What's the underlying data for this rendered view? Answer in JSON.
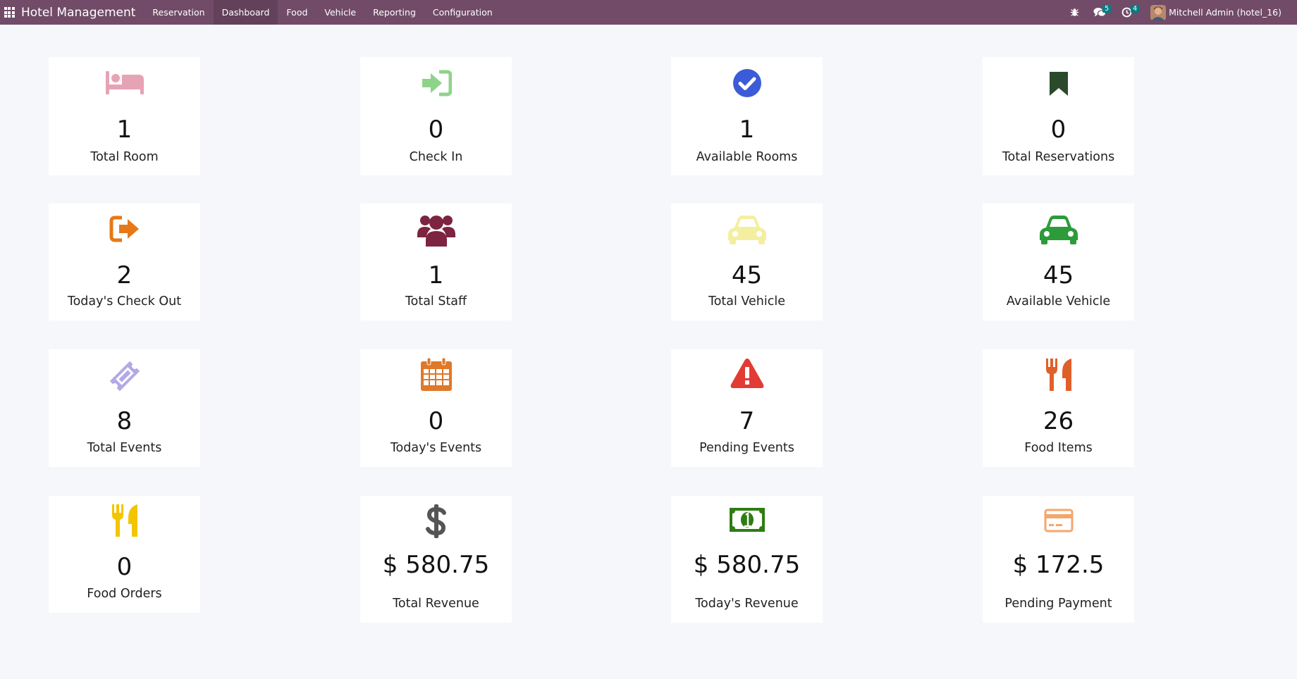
{
  "navbar": {
    "brand": "Hotel Management",
    "menu": [
      "Reservation",
      "Dashboard",
      "Food",
      "Vehicle",
      "Reporting",
      "Configuration"
    ],
    "active_menu": "Dashboard",
    "messages_badge": "5",
    "activities_badge": "4",
    "user": "Mitchell Admin (hotel_16)"
  },
  "cards": [
    {
      "value": "1",
      "label": "Total Room",
      "icon": "bed-icon",
      "color": "#e7a3b6"
    },
    {
      "value": "0",
      "label": "Check In",
      "icon": "sign-in-icon",
      "color": "#8fd38a"
    },
    {
      "value": "1",
      "label": "Available Rooms",
      "icon": "check-circle-icon",
      "color": "#3c5bd8"
    },
    {
      "value": "0",
      "label": "Total Reservations",
      "icon": "bookmark-icon",
      "color": "#2b4a2b"
    },
    {
      "value": "2",
      "label": "Today's Check Out",
      "icon": "sign-out-icon",
      "color": "#e67817"
    },
    {
      "value": "1",
      "label": "Total Staff",
      "icon": "users-icon",
      "color": "#7d2440"
    },
    {
      "value": "45",
      "label": "Total Vehicle",
      "icon": "car-icon",
      "color": "#f4efa0"
    },
    {
      "value": "45",
      "label": "Available Vehicle",
      "icon": "car-icon",
      "color": "#2d9b3a"
    },
    {
      "value": "8",
      "label": "Total Events",
      "icon": "ticket-icon",
      "color": "#b3a9e6"
    },
    {
      "value": "0",
      "label": "Today's Events",
      "icon": "calendar-icon",
      "color": "#e0782a"
    },
    {
      "value": "7",
      "label": "Pending Events",
      "icon": "warning-icon",
      "color": "#e23b33"
    },
    {
      "value": "26",
      "label": "Food Items",
      "icon": "cutlery-icon",
      "color": "#e0602a"
    },
    {
      "value": "0",
      "label": "Food Orders",
      "icon": "cutlery-icon",
      "color": "#f2c500"
    },
    {
      "value": "$ 580.75",
      "label": "Total Revenue",
      "icon": "dollar-icon",
      "color": "#555555"
    },
    {
      "value": "$ 580.75",
      "label": "Today's Revenue",
      "icon": "money-icon",
      "color": "#2e7d12"
    },
    {
      "value": "$ 172.5",
      "label": "Pending Payment",
      "icon": "credit-card-icon",
      "color": "#f5a66b"
    }
  ]
}
